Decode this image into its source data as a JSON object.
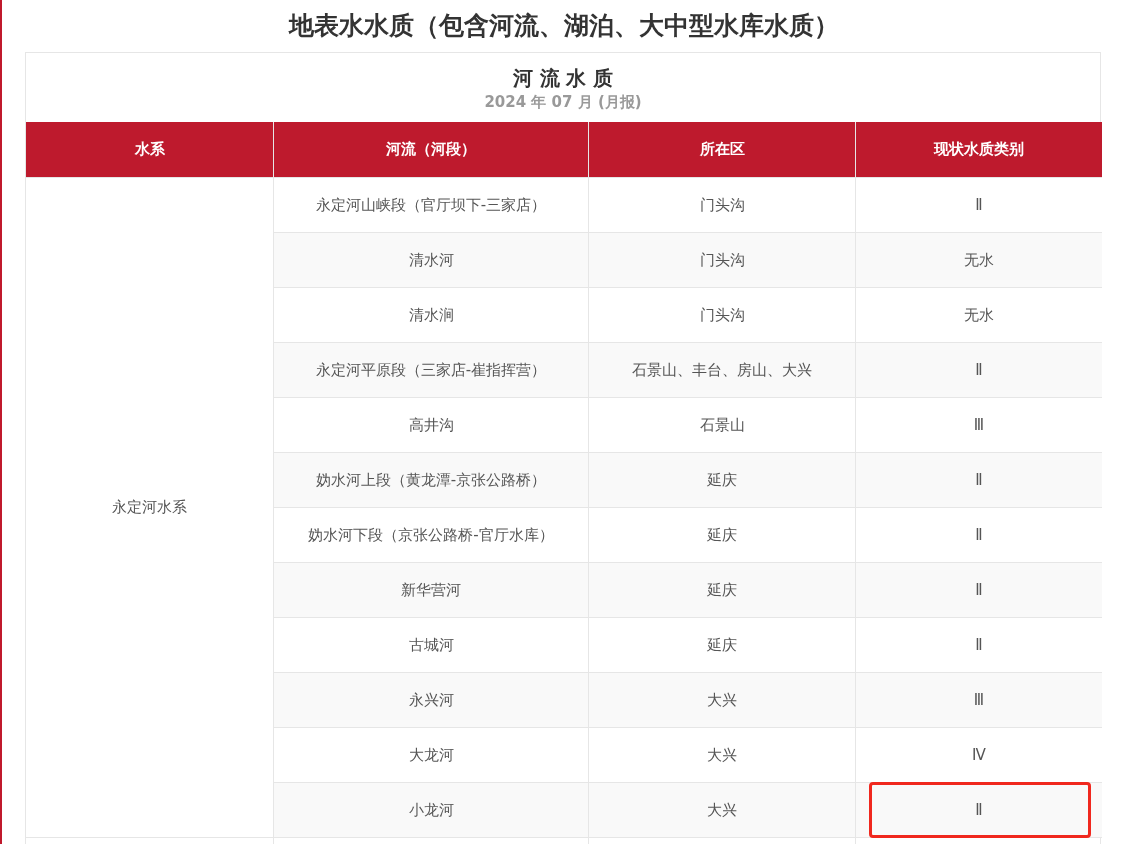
{
  "page_title": "地表水水质（包含河流、湖泊、大中型水库水质）",
  "table": {
    "title": "河 流 水 质",
    "period": "2024 年 07 月 (月报)",
    "columns": [
      "水系",
      "河流（河段）",
      "所在区",
      "现状水质类别"
    ],
    "groups": [
      {
        "system": "永定河水系",
        "rows": [
          {
            "river": "永定河山峡段（官厅坝下-三家店）",
            "district": "门头沟",
            "quality": "Ⅱ",
            "highlighted": false
          },
          {
            "river": "清水河",
            "district": "门头沟",
            "quality": "无水",
            "highlighted": false
          },
          {
            "river": "清水涧",
            "district": "门头沟",
            "quality": "无水",
            "highlighted": false
          },
          {
            "river": "永定河平原段（三家店-崔指挥营）",
            "district": "石景山、丰台、房山、大兴",
            "quality": "Ⅱ",
            "highlighted": false
          },
          {
            "river": "高井沟",
            "district": "石景山",
            "quality": "Ⅲ",
            "highlighted": false
          },
          {
            "river": "妫水河上段（黄龙潭-京张公路桥）",
            "district": "延庆",
            "quality": "Ⅱ",
            "highlighted": false
          },
          {
            "river": "妫水河下段（京张公路桥-官厅水库）",
            "district": "延庆",
            "quality": "Ⅱ",
            "highlighted": false
          },
          {
            "river": "新华营河",
            "district": "延庆",
            "quality": "Ⅱ",
            "highlighted": false
          },
          {
            "river": "古城河",
            "district": "延庆",
            "quality": "Ⅱ",
            "highlighted": false
          },
          {
            "river": "永兴河",
            "district": "大兴",
            "quality": "Ⅲ",
            "highlighted": false
          },
          {
            "river": "大龙河",
            "district": "大兴",
            "quality": "Ⅳ",
            "highlighted": false
          },
          {
            "river": "小龙河",
            "district": "大兴",
            "quality": "Ⅱ",
            "highlighted": true
          }
        ]
      }
    ]
  }
}
